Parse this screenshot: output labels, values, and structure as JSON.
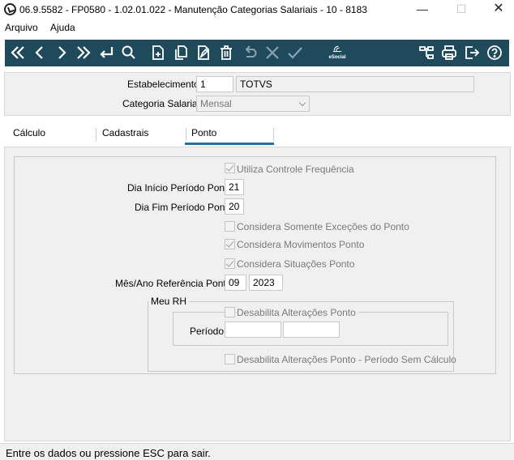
{
  "window": {
    "title": "06.9.5582 - FP0580 - 1.02.01.022 - Manutenção Categorias Salariais - 10 - 8183",
    "minimize": "—",
    "maximize": "☐",
    "close": "✕"
  },
  "menu": {
    "items": [
      "Arquivo",
      "Ajuda"
    ]
  },
  "toolbar": {
    "accent": "#1e4a5c",
    "buttons": [
      {
        "name": "first-record-icon"
      },
      {
        "name": "previous-record-icon"
      },
      {
        "name": "next-record-icon"
      },
      {
        "name": "last-record-icon"
      },
      {
        "name": "enter-icon"
      },
      {
        "name": "search-icon"
      },
      {
        "name": "new-document-icon"
      },
      {
        "name": "copy-document-icon"
      },
      {
        "name": "edit-document-icon"
      },
      {
        "name": "delete-icon"
      },
      {
        "name": "undo-icon"
      },
      {
        "name": "cancel-icon"
      },
      {
        "name": "confirm-icon"
      },
      {
        "name": "esocial-icon"
      },
      {
        "name": "structure-icon"
      },
      {
        "name": "print-icon"
      },
      {
        "name": "exit-icon"
      },
      {
        "name": "help-icon"
      }
    ],
    "esocial_label": "eSocial"
  },
  "header_form": {
    "estabelecimento_label": "Estabelecimento:",
    "estabelecimento_code": "1",
    "estabelecimento_name": "TOTVS",
    "categoria_label": "Categoria Salarial:",
    "categoria_value": "Mensal"
  },
  "tabs": [
    {
      "label": "Cálculo"
    },
    {
      "label": "Cadastrais"
    },
    {
      "label": "Ponto"
    }
  ],
  "ponto": {
    "utiliza_controle": {
      "label": "Utiliza Controle Frequência",
      "checked": true
    },
    "dia_inicio_label": "Dia Início Período Ponto:",
    "dia_inicio_value": "21",
    "dia_fim_label": "Dia Fim Período Ponto:",
    "dia_fim_value": "20",
    "considera_excecoes": {
      "label": "Considera Somente Exceções do Ponto",
      "checked": false
    },
    "considera_movimentos": {
      "label": "Considera Movimentos Ponto",
      "checked": true
    },
    "considera_situacoes": {
      "label": "Considera Situações Ponto",
      "checked": true
    },
    "mes_ano_label": "Mês/Ano Referência Ponto:",
    "mes_value": "09",
    "ano_value": "2023",
    "meu_rh": {
      "legend": "Meu RH",
      "desabilita_alteracoes": {
        "label": "Desabilita Alterações Ponto",
        "checked": false
      },
      "periodo_label": "Período:",
      "periodo_inicio": "",
      "periodo_fim": "",
      "desabilita_sem_calculo": {
        "label": "Desabilita Alterações Ponto - Período Sem Cálculo",
        "checked": false
      }
    }
  },
  "status": {
    "text": "Entre os dados ou pressione ESC para sair."
  }
}
